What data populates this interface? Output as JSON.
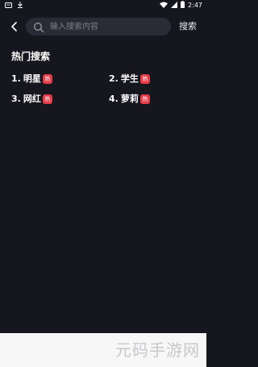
{
  "status_bar": {
    "time": "2:47",
    "left_icons": [
      "message-icon",
      "download-icon"
    ],
    "right_icons": [
      "wifi-icon",
      "signal-icon",
      "battery-icon"
    ]
  },
  "search": {
    "placeholder": "输入搜索内容",
    "value": "",
    "button_label": "搜索"
  },
  "hot_search": {
    "title": "热门搜索",
    "items": [
      {
        "rank": "1.",
        "label": "明星",
        "badge": "热"
      },
      {
        "rank": "2.",
        "label": "学生",
        "badge": "热"
      },
      {
        "rank": "3.",
        "label": "网红",
        "badge": "热"
      },
      {
        "rank": "4.",
        "label": "萝莉",
        "badge": "热"
      }
    ]
  },
  "watermark": {
    "text": "元码手游网"
  },
  "colors": {
    "background": "#16161f",
    "search_box": "#2a2b36",
    "badge": "#e63a46",
    "bottom_band": "#f7f7f8"
  }
}
